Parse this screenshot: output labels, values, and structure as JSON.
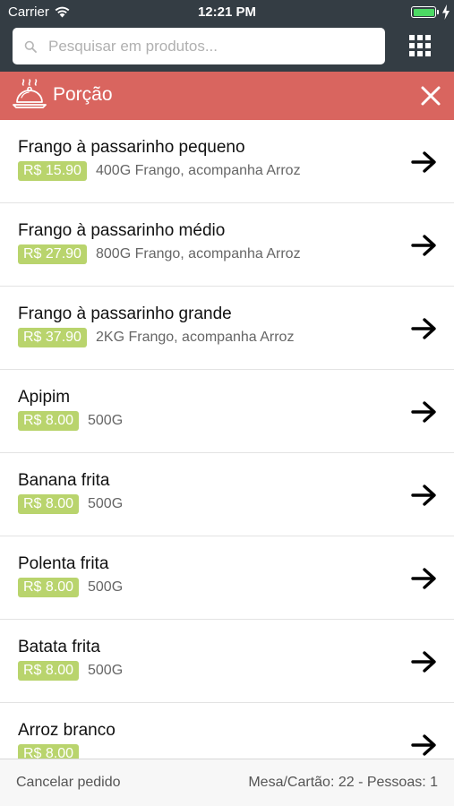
{
  "status_bar": {
    "carrier": "Carrier",
    "time": "12:21 PM",
    "battery_color": "#4cd964"
  },
  "search": {
    "placeholder": "Pesquisar em produtos...",
    "icon": "search-icon"
  },
  "grid_menu": {
    "icon": "grid-icon"
  },
  "category": {
    "title": "Porção",
    "icon": "cloche-icon",
    "close_icon": "close-icon",
    "color": "#d9655f"
  },
  "products": [
    {
      "name": "Frango à passarinho pequeno",
      "price": "R$ 15.90",
      "description": "400G Frango, acompanha Arroz"
    },
    {
      "name": "Frango à passarinho médio",
      "price": "R$ 27.90",
      "description": "800G Frango, acompanha Arroz"
    },
    {
      "name": "Frango à passarinho grande",
      "price": "R$ 37.90",
      "description": "2KG Frango, acompanha Arroz"
    },
    {
      "name": "Apipim",
      "price": "R$ 8.00",
      "description": "500G"
    },
    {
      "name": "Banana frita",
      "price": "R$ 8.00",
      "description": "500G"
    },
    {
      "name": "Polenta frita",
      "price": "R$ 8.00",
      "description": "500G"
    },
    {
      "name": "Batata frita",
      "price": "R$ 8.00",
      "description": "500G"
    },
    {
      "name": "Arroz branco",
      "price": "R$ 8.00",
      "description": ""
    }
  ],
  "price_badge_color": "#b9d46d",
  "footer": {
    "cancel_label": "Cancelar pedido",
    "table_info": "Mesa/Cartão: 22 - Pessoas: 1"
  }
}
